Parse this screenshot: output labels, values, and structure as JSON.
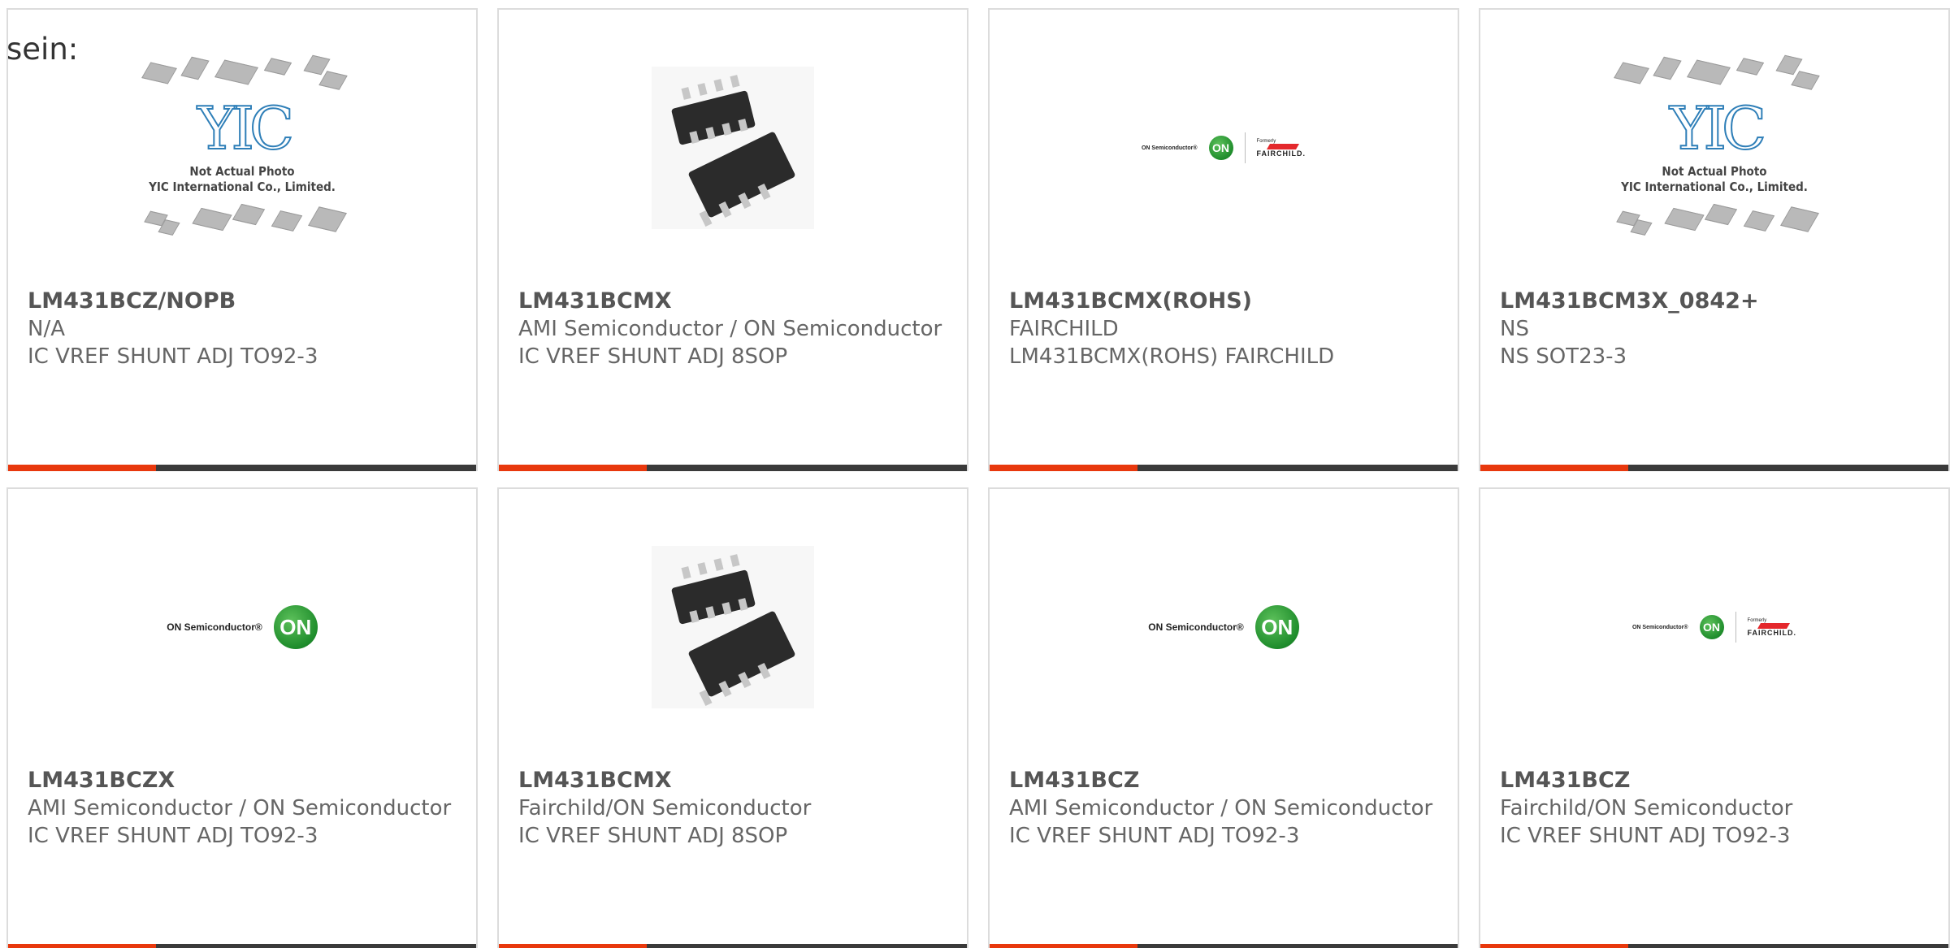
{
  "intro_text": "sein:",
  "placeholder": {
    "logo": "YIC",
    "caption_line1": "Not Actual Photo",
    "caption_line2": "YIC International Co., Limited."
  },
  "on_logo": {
    "wordmark": "ON Semiconductor",
    "mark": "ON",
    "formerly": "Formerly",
    "fairchild": "FAIRCHILD."
  },
  "colors": {
    "accent": "#e8380d",
    "bar": "#3a3a3a",
    "on_green": "#1f8d2c",
    "fairchild_red": "#e4282c"
  },
  "products": [
    {
      "part": "LM431BCZ/NOPB",
      "maker": "N/A",
      "desc": "IC VREF SHUNT ADJ TO92-3",
      "image": "yic-placeholder"
    },
    {
      "part": "LM431BCMX",
      "maker": "AMI Semiconductor / ON Semiconductor",
      "desc": "IC VREF SHUNT ADJ 8SOP",
      "image": "soic8-photo"
    },
    {
      "part": "LM431BCMX(ROHS)",
      "maker": "FAIRCHILD",
      "desc": "LM431BCMX(ROHS) FAIRCHILD",
      "image": "on-fairchild-logo"
    },
    {
      "part": "LM431BCM3X_0842+",
      "maker": "NS",
      "desc": "NS SOT23-3",
      "image": "yic-placeholder"
    },
    {
      "part": "LM431BCZX",
      "maker": "AMI Semiconductor / ON Semiconductor",
      "desc": "IC VREF SHUNT ADJ TO92-3",
      "image": "on-semi-logo"
    },
    {
      "part": "LM431BCMX",
      "maker": "Fairchild/ON Semiconductor",
      "desc": "IC VREF SHUNT ADJ 8SOP",
      "image": "soic8-photo"
    },
    {
      "part": "LM431BCZ",
      "maker": "AMI Semiconductor / ON Semiconductor",
      "desc": "IC VREF SHUNT ADJ TO92-3",
      "image": "on-semi-logo"
    },
    {
      "part": "LM431BCZ",
      "maker": "Fairchild/ON Semiconductor",
      "desc": "IC VREF SHUNT ADJ TO92-3",
      "image": "on-fairchild-logo"
    }
  ]
}
